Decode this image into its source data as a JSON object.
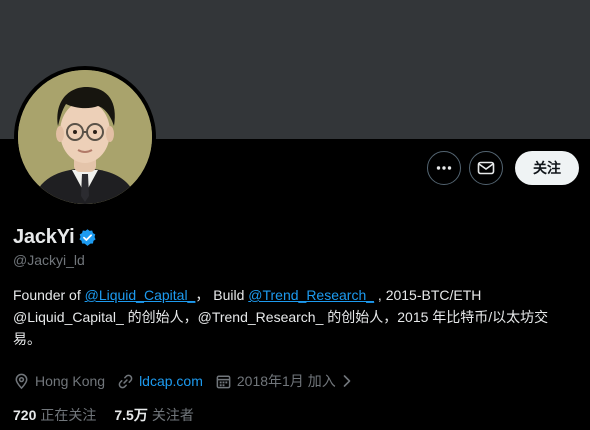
{
  "profile": {
    "display_name": "JackYi",
    "handle": "@Jackyi_ld",
    "verified_color": "#1d9bf0"
  },
  "actions": {
    "more_icon": "more-dots-icon",
    "message_icon": "mail-icon",
    "follow_label": "关注"
  },
  "bio": {
    "line1_prefix": "Founder of ",
    "line1_mention1": "@Liquid_Capital_",
    "line1_mid": "， Build ",
    "line1_mention2": "@Trend_Research_",
    "line1_suffix": " , 2015-BTC/ETH",
    "line2": "@Liquid_Capital_ 的创始人，@Trend_Research_ 的创始人，2015 年比特币/以太坊交",
    "line3": "易。"
  },
  "meta": {
    "location": "Hong Kong",
    "website": "ldcap.com",
    "joined": "2018年1月 加入"
  },
  "stats": {
    "following_count": "720",
    "following_label": "正在关注",
    "followers_count": "7.5万",
    "followers_label": "关注者"
  },
  "colors": {
    "background": "#000000",
    "banner": "#333639",
    "link": "#1d9bf0",
    "muted": "#71767b",
    "text": "#e7e9ea"
  }
}
